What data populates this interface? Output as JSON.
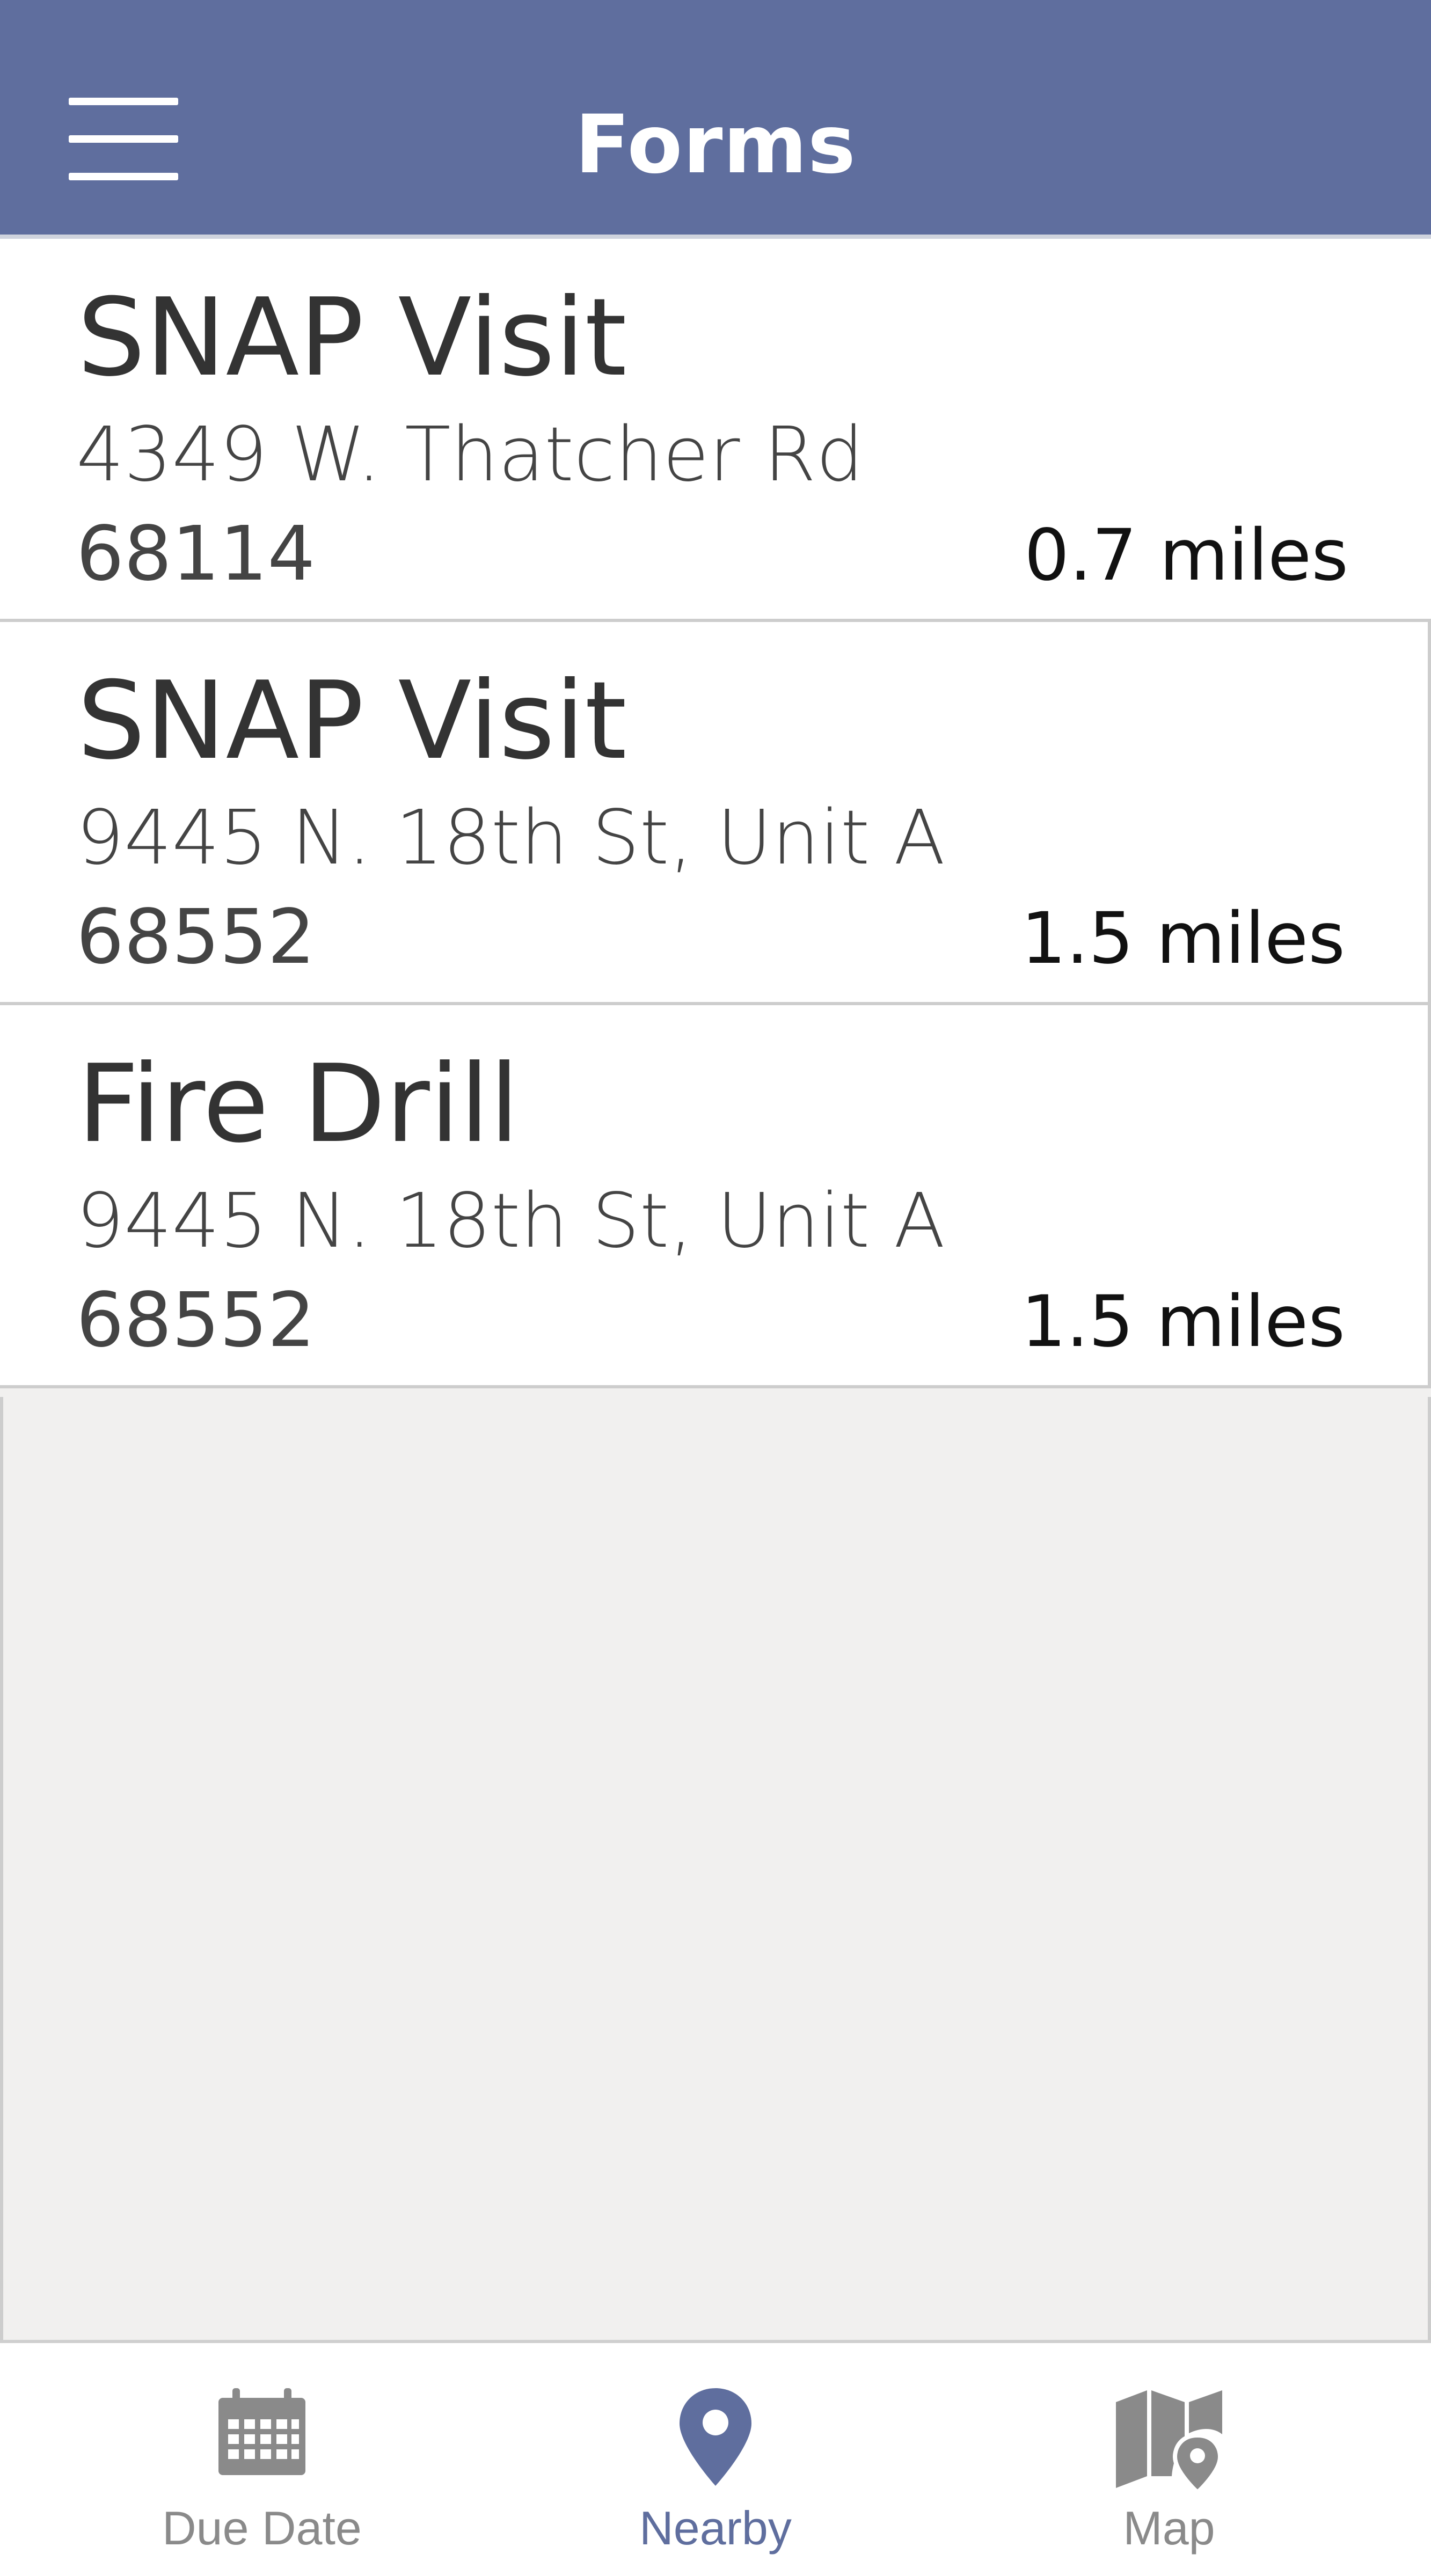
{
  "header": {
    "title": "Forms"
  },
  "forms": [
    {
      "title": "SNAP Visit",
      "address": "4349 W. Thatcher Rd",
      "zip": "68114",
      "distance": "0.7 miles"
    },
    {
      "title": "SNAP Visit",
      "address": "9445 N. 18th St, Unit A",
      "zip": "68552",
      "distance": "1.5 miles"
    },
    {
      "title": "Fire Drill",
      "address": "9445 N. 18th St, Unit A",
      "zip": "68552",
      "distance": "1.5 miles"
    }
  ],
  "tabs": [
    {
      "label": "Due Date",
      "icon": "calendar-icon",
      "active": false
    },
    {
      "label": "Nearby",
      "icon": "location-pin-icon",
      "active": true
    },
    {
      "label": "Map",
      "icon": "map-icon",
      "active": false
    }
  ],
  "colors": {
    "header": "#5f6e9e",
    "active_tab": "#5f6e9e",
    "inactive_tab": "#8a8a8a",
    "background": "#f1f0ef"
  }
}
